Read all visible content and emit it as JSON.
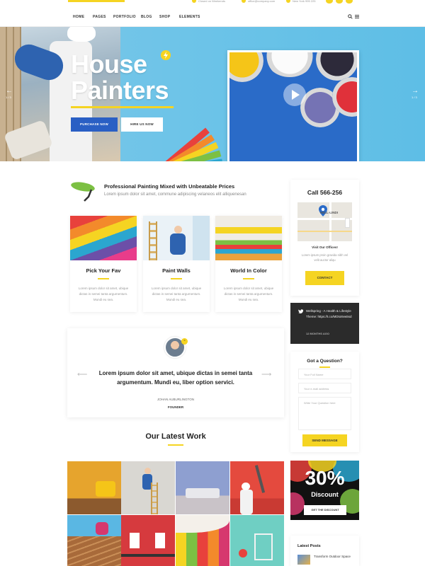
{
  "topbar": {
    "location": "Closed on Weekends",
    "email": "office@company.com",
    "phone": "New York 995 225"
  },
  "nav": {
    "items": [
      "HOME",
      "PAGES",
      "PORTFOLIO",
      "BLOG",
      "SHOP",
      "ELEMENTS"
    ]
  },
  "hero": {
    "title_line1": "House",
    "title_line2": "Painters",
    "primary_button": "PURCHASE NOW",
    "secondary_button": "HIRE US NOW",
    "slide_counter": "1 / 3",
    "prev_arrow": "←",
    "next_arrow": "→"
  },
  "intro": {
    "title": "Professional Painting Mixed with Unbeatable Prices",
    "subtitle": "Lorem ipsum dolor sit amet, commune adipiscing velaneos elit alliquenesan"
  },
  "cards": [
    {
      "title": "Pick Your Fav",
      "text": "Lorem ipsum dolor sit amet, ubique dictas in semei tanta argumentum. Mundi eu sea."
    },
    {
      "title": "Paint Walls",
      "text": "Lorem ipsum dolor sit amet, ubique dictas in semei tanta argumentum. Mundi eu sea."
    },
    {
      "title": "World In Color",
      "text": "Lorem ipsum dolor sit amet, ubique dictas in semei tanta argumentum. Mundi eu sea."
    }
  ],
  "testimonial": {
    "quote": "Lorem ipsum dolor sit amet, ubique dictas in semei tanta argumentum. Mundi eu, liber option servici.",
    "name": "JOHAN AUBURLINGTON",
    "role": "FOUNDER",
    "prev_arrow": "⟵",
    "next_arrow": "⟶"
  },
  "latest_work": {
    "title": "Our Latest Work"
  },
  "sidebar": {
    "call": {
      "title": "Call 566-256",
      "map_label": "HELL-LINDI",
      "visit_title": "Visit Our Offices!",
      "visit_text": "Lorem ipsum proin gravida nibh vel velit auctor aliqu",
      "button": "CONTACT"
    },
    "tweet": {
      "text": "Wellspring - A Health & Lifestyle Theme: https://t.co/MDto8vw5sd",
      "time": "12 MONTHS AGO"
    },
    "question": {
      "title": "Got a Question?",
      "name_placeholder": "Your Full Name",
      "email_placeholder": "Your e-mail address",
      "message_placeholder": "Write Your Question here",
      "button": "SEND MESSAGE"
    },
    "promo": {
      "percent": "30%",
      "label": "Discount",
      "button": "GET THE DISCOUNT"
    },
    "latest_posts": {
      "title": "Latest Posts",
      "item": "Transform Outdoor Space"
    }
  },
  "colors": {
    "accent": "#f5d422",
    "primary_blue": "#2a5fc4",
    "hero_sky": "#6ec4e8"
  }
}
